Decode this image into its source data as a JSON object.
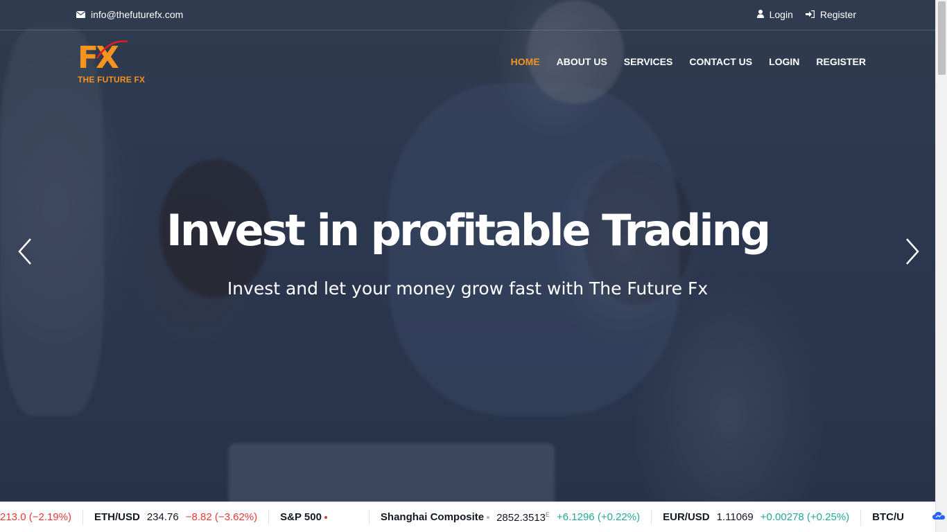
{
  "topbar": {
    "email": "info@thefuturefx.com",
    "login_label": "Login",
    "register_label": "Register"
  },
  "logo": {
    "mark": "FX",
    "text": "THE FUTURE FX"
  },
  "nav": {
    "items": [
      {
        "label": "HOME",
        "active": true
      },
      {
        "label": "ABOUT US",
        "active": false
      },
      {
        "label": "SERVICES",
        "active": false
      },
      {
        "label": "CONTACT US",
        "active": false
      },
      {
        "label": "LOGIN",
        "active": false
      },
      {
        "label": "REGISTER",
        "active": false
      }
    ]
  },
  "hero": {
    "headline": "Invest in profitable Trading",
    "subline": "Invest and let your money grow fast with The Future Fx"
  },
  "ticker": {
    "items": [
      {
        "symbol": "",
        "price": "",
        "change": "213.0 (−2.19%)",
        "direction": "neg"
      },
      {
        "symbol": "ETH/USD",
        "price": "234.76",
        "change": "−8.82 (−3.62%)",
        "direction": "neg"
      },
      {
        "symbol": "S&P 500",
        "price": "",
        "change": "",
        "direction": "neg"
      },
      {
        "symbol": "Shanghai Composite",
        "price": "2852.3513",
        "price_sup": "E",
        "change": "+6.1296 (+0.22%)",
        "direction": "pos"
      },
      {
        "symbol": "EUR/USD",
        "price": "1.11069",
        "change": "+0.00278 (+0.25%)",
        "direction": "pos"
      },
      {
        "symbol": "BTC/U",
        "price": "",
        "change": "",
        "direction": "neg"
      }
    ]
  },
  "colors": {
    "accent": "#f7941d",
    "negative": "#e53935",
    "positive": "#26a69a"
  },
  "icons": {
    "email": "envelope-icon",
    "login": "user-icon",
    "register": "sign-in-icon",
    "prev": "chevron-left-icon",
    "next": "chevron-right-icon"
  }
}
